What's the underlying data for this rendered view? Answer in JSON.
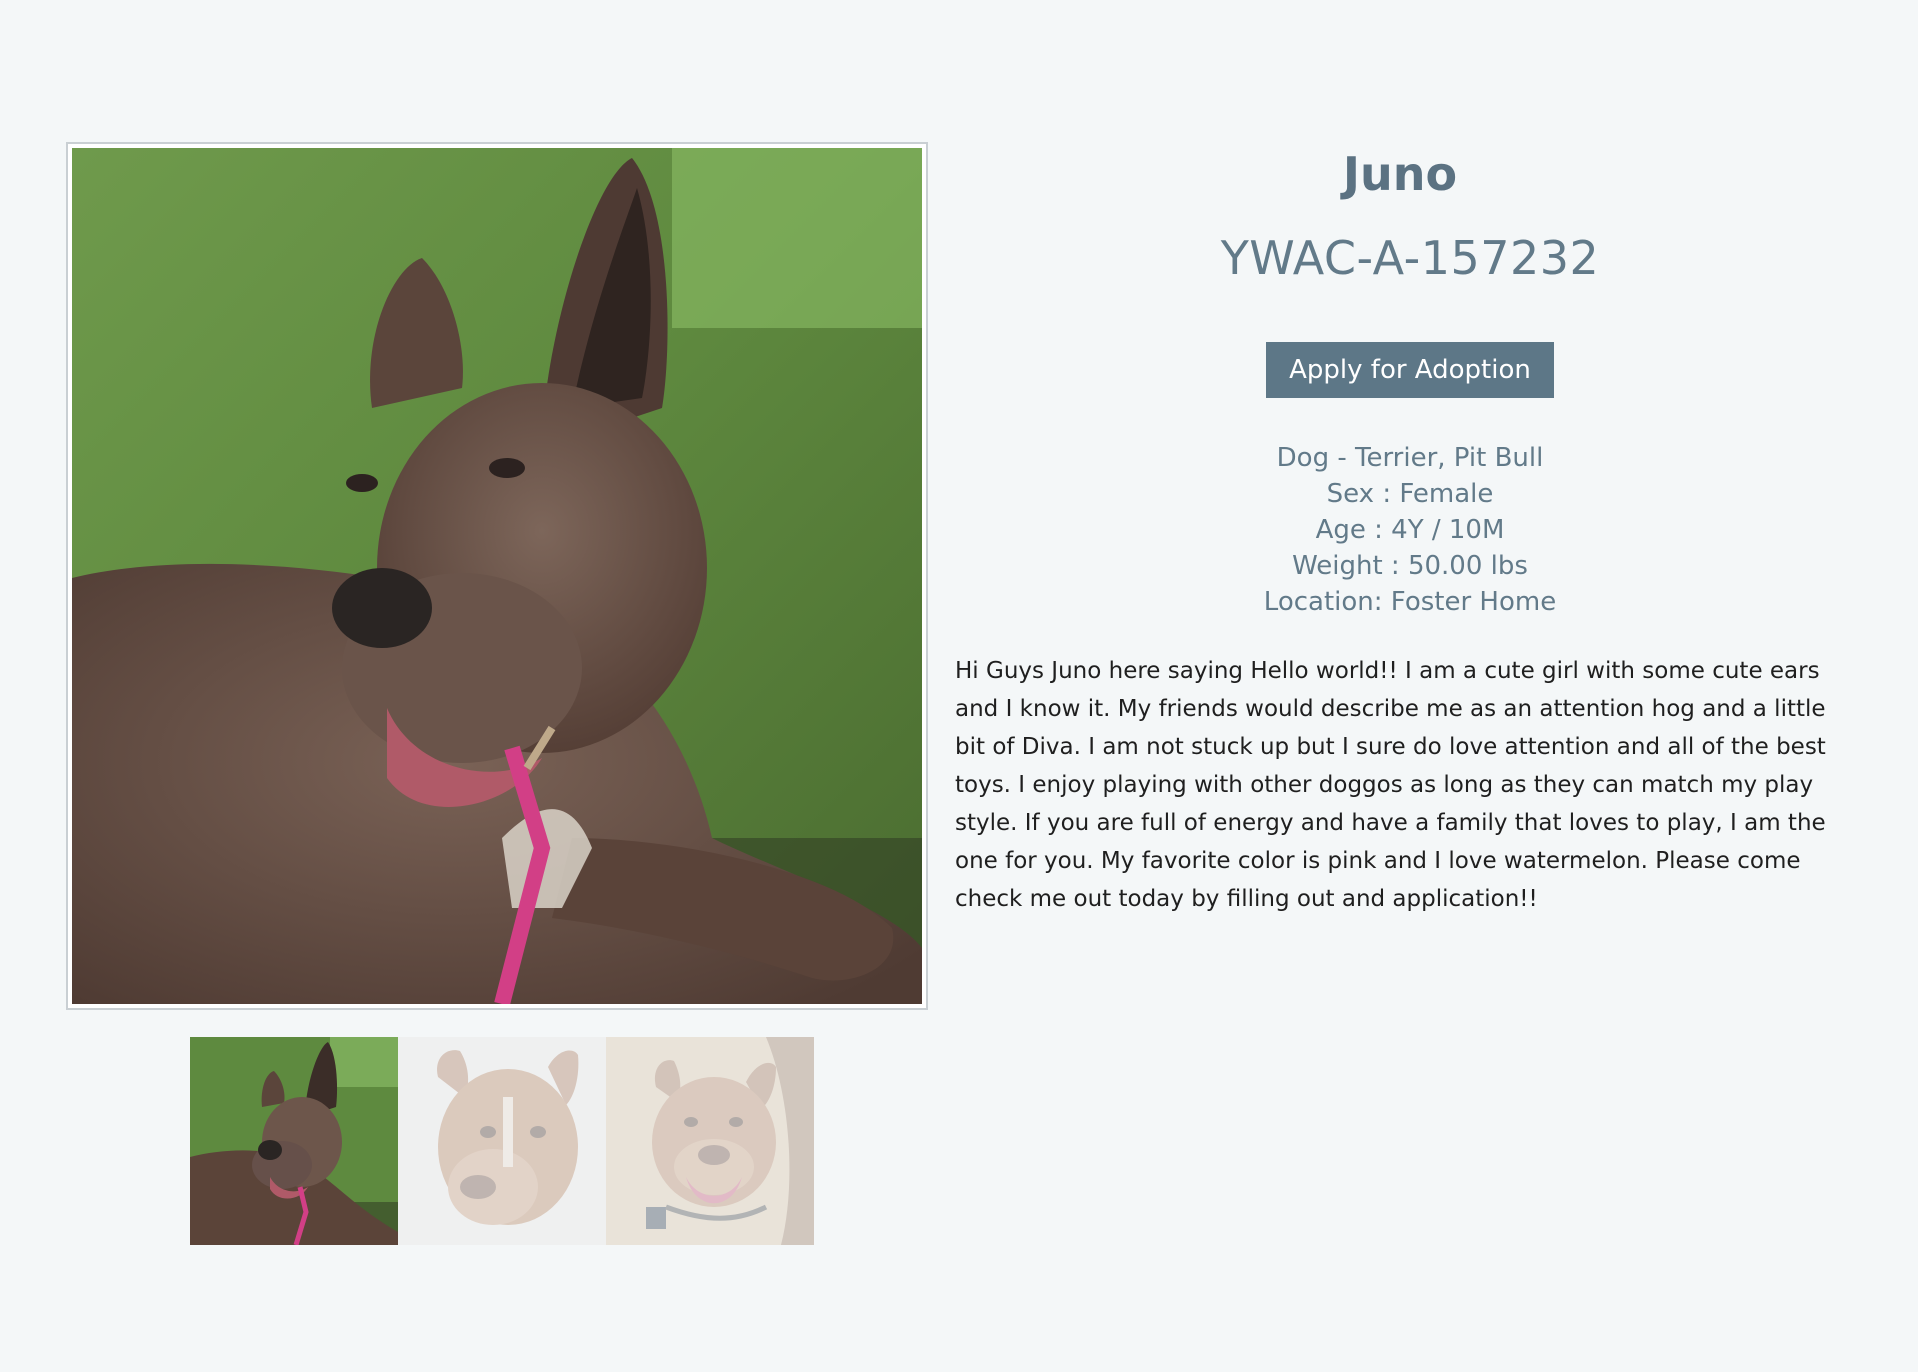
{
  "pet": {
    "name": "Juno",
    "id": "YWAC-A-157232",
    "apply_label": "Apply for Adoption",
    "facts": {
      "species_breed": "Dog - Terrier, Pit Bull",
      "sex": "Sex : Female",
      "age": "Age : 4Y / 10M",
      "weight": "Weight : 50.00 lbs",
      "location": "Location: Foster Home"
    },
    "description": "Hi Guys Juno here saying Hello world!! I am a cute girl with some cute ears and I know it. My friends would describe me as an attention hog and a little bit of Diva. I am not stuck up but I sure do love attention and all of the best toys. I enjoy playing with other doggos as long as they can match my play style. If you are full of energy and have a family that loves to play, I am the one for you. My favorite color is pink and I love watermelon. Please come check me out today by filling out and application!!"
  },
  "gallery": {
    "selected_index": 0,
    "photos": [
      {
        "icon": "dog-photo-grass"
      },
      {
        "icon": "dog-photo-closeup"
      },
      {
        "icon": "dog-photo-smiling"
      }
    ]
  },
  "colors": {
    "background": "#f4f7f8",
    "accent": "#5d7787",
    "text_muted": "#627a89",
    "body_text": "#1f1f1f"
  }
}
